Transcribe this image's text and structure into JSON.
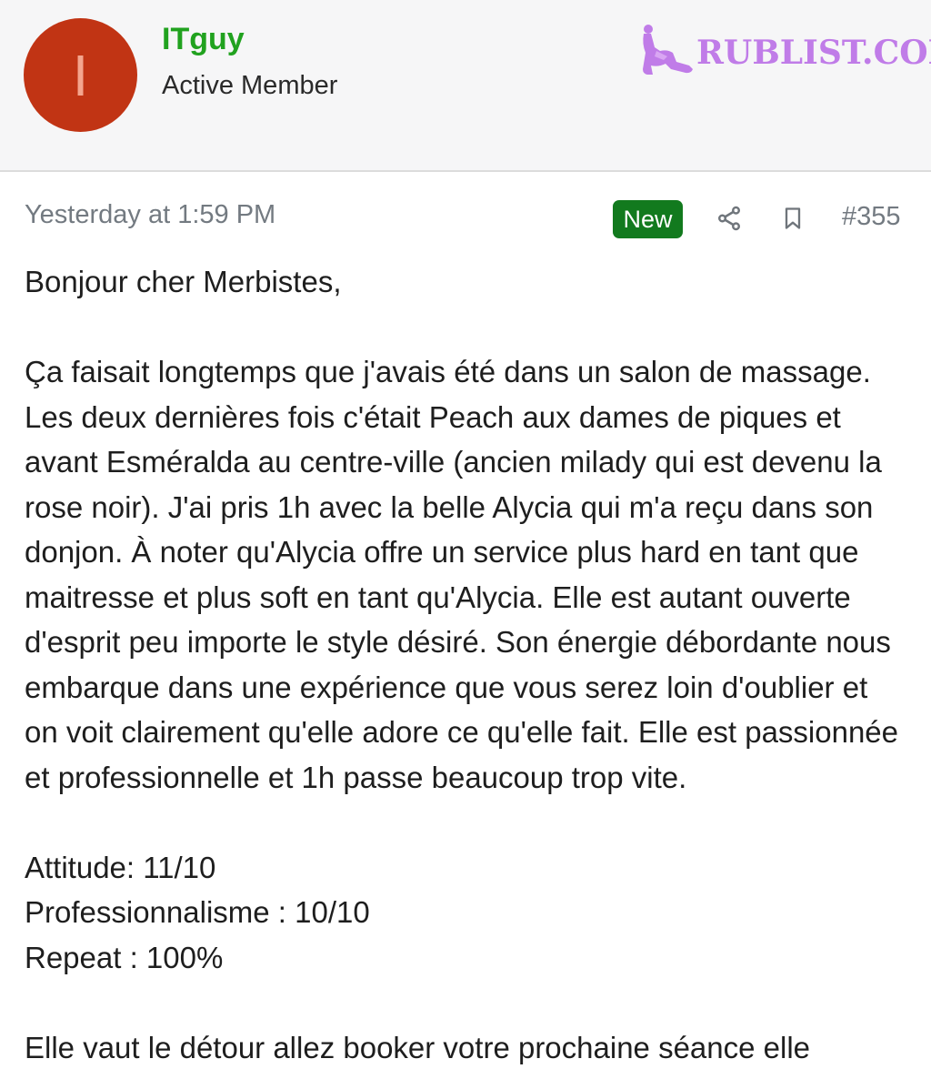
{
  "user": {
    "avatar_letter": "I",
    "name": "ITguy",
    "title": "Active Member",
    "avatar_color": "#c13414",
    "name_color": "#21a21f"
  },
  "brand": {
    "text": "RUBLIST.COM",
    "color": "#c07ce8"
  },
  "post": {
    "timestamp": "Yesterday at 1:59 PM",
    "badge": "New",
    "number": "#355",
    "share_icon": "share-icon",
    "bookmark_icon": "bookmark-icon",
    "greeting": "Bonjour cher Merbistes,",
    "paragraph": "Ça faisait longtemps que j'avais été dans un salon de massage. Les deux dernières fois c'était Peach aux dames de piques et avant Esméralda au centre-ville (ancien milady qui est devenu la rose noir). J'ai pris 1h avec la belle Alycia qui m'a reçu dans son donjon. À noter qu'Alycia offre un service plus hard en tant que maitresse et plus soft en tant qu'Alycia. Elle est autant ouverte d'esprit peu importe le style désiré. Son énergie débordante nous embarque dans une expérience que vous serez loin d'oublier et on voit clairement qu'elle adore ce qu'elle fait. Elle est passionnée et professionnelle et 1h passe beaucoup trop vite.",
    "ratings": [
      "Attitude: 11/10",
      "Professionnalisme : 10/10",
      "Repeat : 100%"
    ],
    "closing_partial": "Elle vaut le détour allez booker votre prochaine séance elle",
    "badge_color": "#127a1e"
  }
}
